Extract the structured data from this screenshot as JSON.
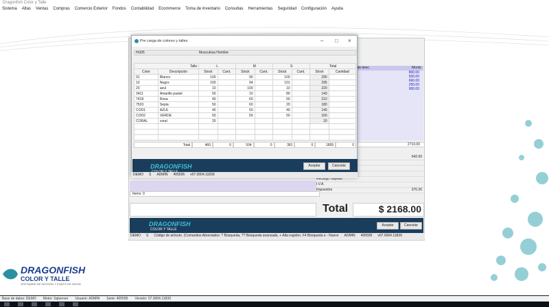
{
  "app": {
    "title": "Dragonfish Color y Talle",
    "menu": [
      "Sistema",
      "Altas",
      "Ventas",
      "Compras",
      "Comercio Exterior",
      "Fondos",
      "Contabilidad",
      "Ecommerce",
      "Toma de inventario",
      "Consultas",
      "Herramientas",
      "Seguridad",
      "Configuración",
      "Ayuda"
    ]
  },
  "background_form": {
    "grid_header": [
      "Monto desc.",
      "Monto"
    ],
    "grid_values": [
      "800.00",
      "500.00",
      "660.00",
      "250.00",
      "900.00"
    ],
    "grid_total": "2710.00",
    "side_rows": [
      {
        "label": "",
        "value": "542.00"
      },
      {
        "label": "",
        "value": ""
      },
      {
        "label": "",
        "value": ""
      },
      {
        "label": "",
        "value": ""
      },
      {
        "label": "Recargo Tarjetas",
        "value": ""
      },
      {
        "label": "I.V.A.",
        "value": ""
      },
      {
        "label": "Impuestos",
        "value": "376.26"
      }
    ],
    "items_label": "Items: 0",
    "total_label": "Total",
    "total_value": "$ 2168.00",
    "accept": "Aceptar",
    "cancel": "Cancelar",
    "status": [
      "DEMO",
      "S",
      "Código de artículo. (Comandos Abreviados: ? Búsqueda, ?? Búsqueda avanzada, + Alta registro, F4 Búsqueda e - Nuevo",
      "ADMIN",
      "405595",
      "v07.0004.11839"
    ]
  },
  "dialog": {
    "title": "Pre carga de colores y talles",
    "filter": [
      "HU05",
      "Musculosa Hombre"
    ],
    "group_headers": [
      "Talle",
      "L",
      "M",
      "S",
      "Total"
    ],
    "col_headers": [
      "Color",
      "Descripción",
      "Stock",
      "Cant.",
      "Stock",
      "Cant.",
      "Stock",
      "Cant.",
      "Stock",
      "Cantidad"
    ],
    "rows": [
      {
        "c": "01",
        "d": "Blanco",
        "v": [
          "100",
          "",
          "90",
          "",
          "100",
          "",
          "290",
          ""
        ]
      },
      {
        "c": "10",
        "d": "Negro",
        "v": [
          "100",
          "",
          "94",
          "",
          "101",
          "",
          "295",
          ""
        ]
      },
      {
        "c": "20",
        "d": "azul",
        "v": [
          "10",
          "",
          "100",
          "",
          "10",
          "",
          "220",
          ""
        ]
      },
      {
        "c": "3411",
        "d": "Amarillo pastel",
        "v": [
          "50",
          "",
          "10",
          "",
          "80",
          "",
          "140",
          ""
        ]
      },
      {
        "c": "7418",
        "d": "Rosa",
        "v": [
          "40",
          "",
          "60",
          "",
          "50",
          "",
          "210",
          ""
        ]
      },
      {
        "c": "7533",
        "d": "Sepia",
        "v": [
          "50",
          "",
          "60",
          "",
          "20",
          "",
          "180",
          ""
        ]
      },
      {
        "c": "COD1",
        "d": "AZUL",
        "v": [
          "40",
          "",
          "50",
          "",
          "40",
          "",
          "140",
          ""
        ]
      },
      {
        "c": "COD2",
        "d": "VERDE",
        "v": [
          "50",
          "",
          "50",
          "",
          "50",
          "",
          "160",
          ""
        ]
      },
      {
        "c": "CORAL",
        "d": "coral",
        "v": [
          "20",
          "",
          "",
          "",
          "",
          "",
          "20",
          ""
        ]
      }
    ],
    "totals_label": "Total",
    "totals": [
      "460",
      "0",
      "534",
      "0",
      "381",
      "0",
      "1855",
      "0"
    ],
    "accept": "Aceptar",
    "cancel": "Cancelar",
    "status": [
      "DEMO",
      "S",
      "ADMIN",
      "405595",
      "v07.0004.11839"
    ]
  },
  "brand": {
    "name": "DRAGONFISH",
    "sub": "COLOR Y TALLE",
    "tag": "SOFTWARE DE GESTIÓN Y PUNTO DE VENTA"
  },
  "main_status": [
    "Base de datos: DEMO",
    "Motor: Sqlserver",
    "Usuario: ADMIN",
    "Serie: 405595",
    "Versión: 07.0004.11839"
  ]
}
